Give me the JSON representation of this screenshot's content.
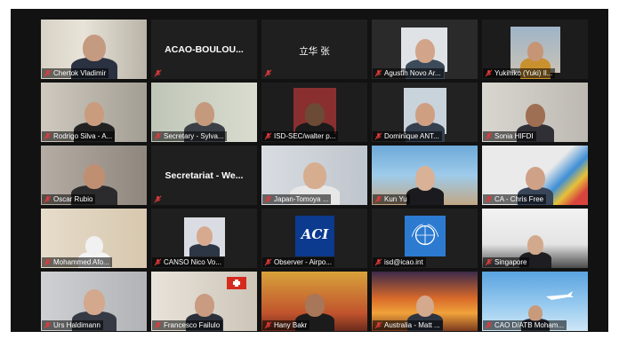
{
  "participants": [
    {
      "label": "Chertok Vladimir"
    },
    {
      "name_only": "ACAO-BOULOU..."
    },
    {
      "name_only": "立华 张"
    },
    {
      "label": "Agustin Novo Ar..."
    },
    {
      "label": "Yukihiko (Yuki) Il..."
    },
    {
      "label": "Rodrigo Silva - A..."
    },
    {
      "label": "Secretary - Sylva..."
    },
    {
      "label": "ISD-SEC/walter p..."
    },
    {
      "label": "Dominique ANT..."
    },
    {
      "label": "Sonia HIFDI"
    },
    {
      "label": "Oscar Rubio"
    },
    {
      "name_only": "Secretariat - We..."
    },
    {
      "label": "Japan-Tomoya ..."
    },
    {
      "label": "Kun Yu"
    },
    {
      "label": "CA - Chris Free"
    },
    {
      "label": "Mohammed Afo..."
    },
    {
      "label": "CANSO Nico Vo..."
    },
    {
      "label": "Observer - Airpo..."
    },
    {
      "label": "isd@icao.int"
    },
    {
      "label": "Singapore"
    },
    {
      "label": "Urs Haldimann"
    },
    {
      "label": "Francesco Failulo"
    },
    {
      "label": "Hany Bakr"
    },
    {
      "label": "Australia - Matt ..."
    },
    {
      "label": "CAO D/ATB Moham..."
    }
  ],
  "logos": {
    "aci": "ACI"
  },
  "colors": {
    "muted_mic": "#e03a3a",
    "active_speaker_border": "#8fd14f",
    "background": "#121212"
  }
}
